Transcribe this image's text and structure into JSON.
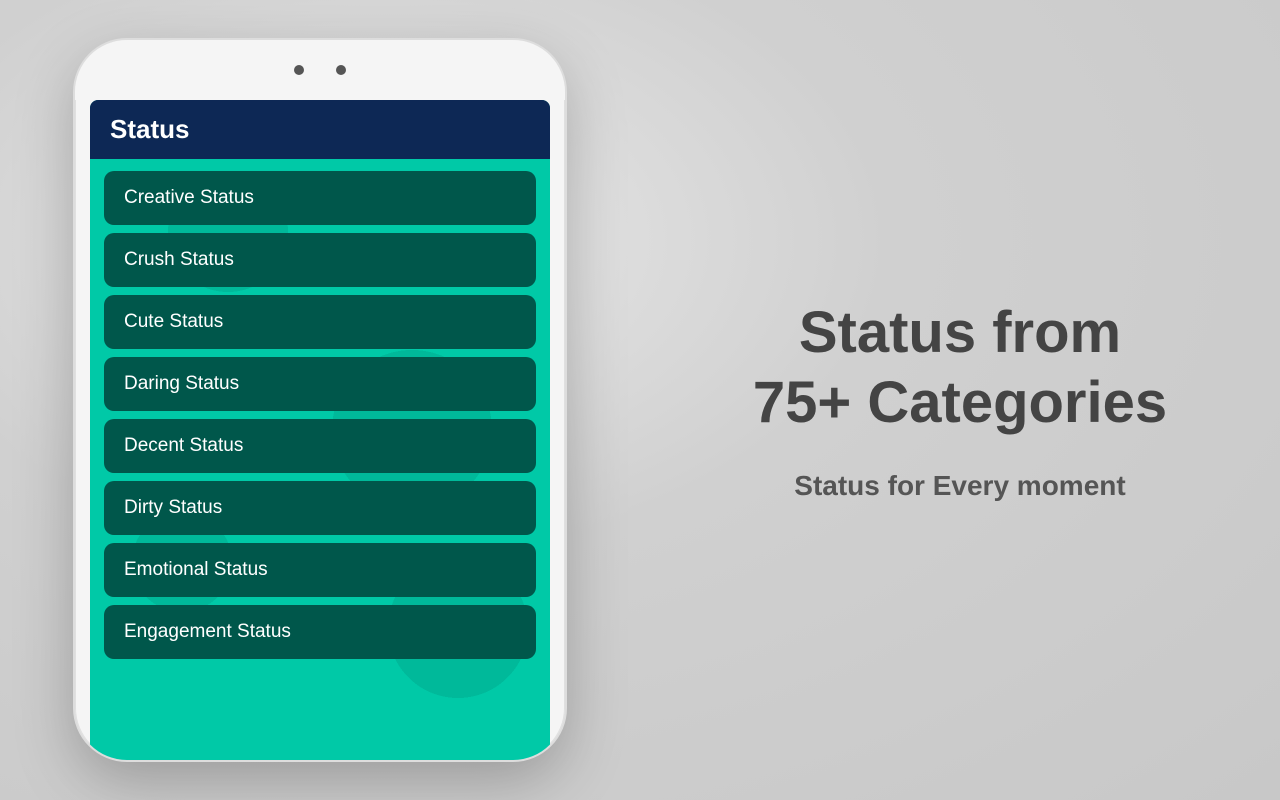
{
  "phone": {
    "app_header": {
      "title": "Status"
    },
    "menu_items": [
      {
        "id": "creative",
        "label": "Creative Status"
      },
      {
        "id": "crush",
        "label": "Crush Status"
      },
      {
        "id": "cute",
        "label": "Cute Status"
      },
      {
        "id": "daring",
        "label": "Daring Status"
      },
      {
        "id": "decent",
        "label": "Decent Status"
      },
      {
        "id": "dirty",
        "label": "Dirty Status"
      },
      {
        "id": "emotional",
        "label": "Emotional Status"
      },
      {
        "id": "engagement",
        "label": "Engagement Status"
      }
    ]
  },
  "right": {
    "main_heading": "Status from\n75+ Categories",
    "sub_heading": "Status for Every moment"
  }
}
